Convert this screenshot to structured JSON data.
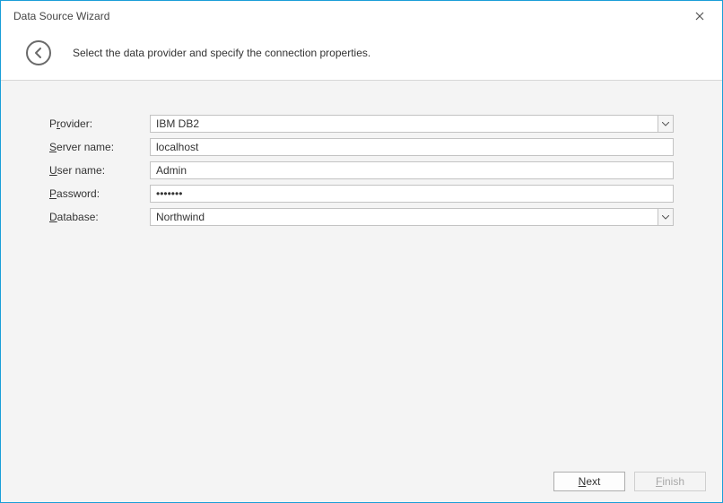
{
  "window": {
    "title": "Data Source Wizard"
  },
  "header": {
    "instruction": "Select the data provider and specify the connection properties."
  },
  "form": {
    "provider": {
      "label_pre": "P",
      "label_u": "r",
      "label_post": "ovider:",
      "value": "IBM DB2"
    },
    "server": {
      "label_pre": "",
      "label_u": "S",
      "label_post": "erver name:",
      "value": "localhost"
    },
    "user": {
      "label_pre": "",
      "label_u": "U",
      "label_post": "ser name:",
      "value": "Admin"
    },
    "password": {
      "label_pre": "",
      "label_u": "P",
      "label_post": "assword:",
      "value": "•••••••"
    },
    "database": {
      "label_pre": "",
      "label_u": "D",
      "label_post": "atabase:",
      "value": "Northwind"
    }
  },
  "footer": {
    "next_pre": "",
    "next_u": "N",
    "next_post": "ext",
    "finish_pre": "",
    "finish_u": "F",
    "finish_post": "inish"
  }
}
